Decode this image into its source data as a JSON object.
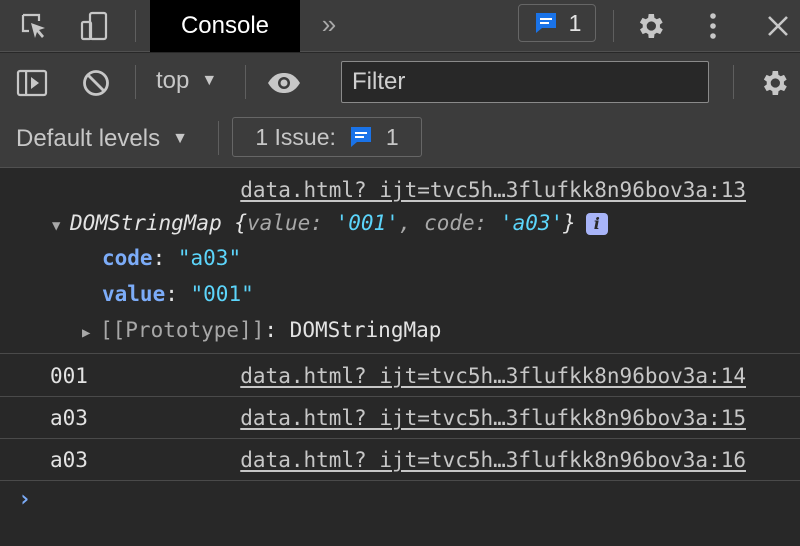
{
  "tabbar": {
    "active_tab": "Console",
    "more_tabs": "»",
    "issues_count": "1"
  },
  "toolbar": {
    "context": "top",
    "filter_placeholder": "Filter",
    "levels": "Default levels",
    "issue_label": "1 Issue:",
    "issue_count": "1"
  },
  "console": {
    "group_source": "data.html?_ijt=tvc5h…3flufkk8n96bov3a:13",
    "object": {
      "class_name": "DOMStringMap",
      "open_brace": "{",
      "k1": "value",
      "v1": "'001'",
      "k2": "code",
      "v2": "'a03'",
      "close_brace": "}",
      "info": "i",
      "props": [
        {
          "key": "code",
          "value": "\"a03\""
        },
        {
          "key": "value",
          "value": "\"001\""
        }
      ],
      "prototype_label": "[[Prototype]]",
      "prototype_value": "DOMStringMap"
    },
    "rows": [
      {
        "text": "001",
        "source": "data.html?_ijt=tvc5h…3flufkk8n96bov3a:14"
      },
      {
        "text": "a03",
        "source": "data.html?_ijt=tvc5h…3flufkk8n96bov3a:15"
      },
      {
        "text": "a03",
        "source": "data.html?_ijt=tvc5h…3flufkk8n96bov3a:16"
      }
    ],
    "prompt": "›"
  },
  "colors": {
    "accent": "#7cacf8",
    "badge": "#a8b4f8",
    "string": "#5cd5fb",
    "background": "#282828",
    "toolbar": "#3c3c3c"
  }
}
